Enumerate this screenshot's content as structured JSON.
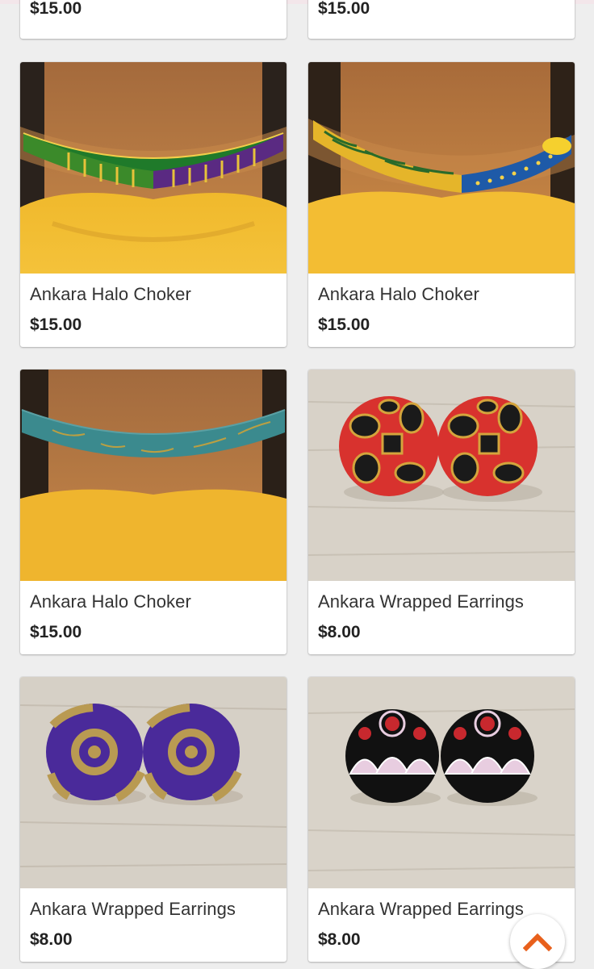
{
  "products": [
    {
      "name": "",
      "price": "$15.00",
      "image": "partial-card-top"
    },
    {
      "name": "",
      "price": "$15.00",
      "image": "partial-card-top"
    },
    {
      "name": "Ankara Halo Choker",
      "price": "$15.00",
      "image": "choker-green-purple-print"
    },
    {
      "name": "Ankara Halo Choker",
      "price": "$15.00",
      "image": "choker-yellow-blue-print"
    },
    {
      "name": "Ankara Halo Choker",
      "price": "$15.00",
      "image": "choker-teal-gold-print"
    },
    {
      "name": "Ankara Wrapped Earrings",
      "price": "$8.00",
      "image": "earrings-red-black-gold"
    },
    {
      "name": "Ankara Wrapped Earrings",
      "price": "$8.00",
      "image": "earrings-purple-gold"
    },
    {
      "name": "Ankara Wrapped Earrings",
      "price": "$8.00",
      "image": "earrings-black-pink-white"
    }
  ],
  "scroll_top": {
    "icon": "chevron-up-icon",
    "color": "#e8601c"
  },
  "colors": {
    "accent": "#e8601c",
    "price_text": "#222222",
    "name_text": "#333333",
    "page_bg": "#eeeeee"
  }
}
